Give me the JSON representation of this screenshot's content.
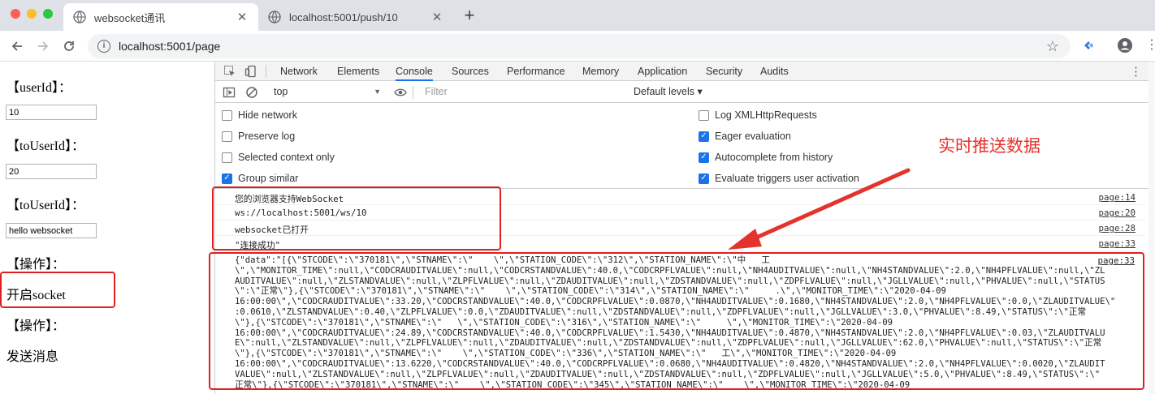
{
  "window": {
    "tabs": [
      {
        "title": "websocket通讯",
        "active": true
      },
      {
        "title": "localhost:5001/push/10",
        "active": false
      }
    ],
    "new_tab_label": "+"
  },
  "toolbar": {
    "url": "localhost:5001/page"
  },
  "page": {
    "userId_label": "【userId】：",
    "userId_value": "10",
    "toUserId_label": "【toUserId】：",
    "toUserId_value": "20",
    "toUserId2_label": "【toUserId】：",
    "message_value": "hello websocket",
    "op1_label": "【操作】：",
    "open_socket": "开启socket",
    "op2_label": "【操作】：",
    "send_message": "发送消息"
  },
  "devtools": {
    "tabs": [
      "Network",
      "Elements",
      "Console",
      "Sources",
      "Performance",
      "Memory",
      "Application",
      "Security",
      "Audits"
    ],
    "active_tab": "Console",
    "context": "top",
    "filter_placeholder": "Filter",
    "levels": "Default levels ▾",
    "settings_left": [
      {
        "label": "Hide network",
        "checked": false
      },
      {
        "label": "Preserve log",
        "checked": false
      },
      {
        "label": "Selected context only",
        "checked": false
      },
      {
        "label": "Group similar",
        "checked": true
      }
    ],
    "settings_right": [
      {
        "label": "Log XMLHttpRequests",
        "checked": false
      },
      {
        "label": "Eager evaluation",
        "checked": true
      },
      {
        "label": "Autocomplete from history",
        "checked": true
      },
      {
        "label": "Evaluate triggers user activation",
        "checked": true
      }
    ],
    "logs": [
      {
        "msg": "您的浏览器支持WebSocket",
        "src": "page:14"
      },
      {
        "msg": "ws://localhost:5001/ws/10",
        "src": "page:20"
      },
      {
        "msg": "websocket已打开",
        "src": "page:28"
      },
      {
        "msg": "\"连接成功\"",
        "src": "page:33"
      }
    ],
    "long_log": {
      "src": "page:33",
      "lines": [
        "{\"data\":\"[{\\\"STCODE\\\":\\\"370181\\\",\\\"STNAME\\\":\\\"    \\\",\\\"STATION_CODE\\\":\\\"312\\\",\\\"STATION_NAME\\\":\\\"中   工",
        "\\\",\\\"MONITOR_TIME\\\":null,\\\"CODCRAUDITVALUE\\\":null,\\\"CODCRSTANDVALUE\\\":40.0,\\\"CODCRPFLVALUE\\\":null,\\\"NH4AUDITVALUE\\\":null,\\\"NH4STANDVALUE\\\":2.0,\\\"NH4PFLVALUE\\\":null,\\\"ZL",
        "AUDITVALUE\\\":null,\\\"ZLSTANDVALUE\\\":null,\\\"ZLPFLVALUE\\\":null,\\\"ZDAUDITVALUE\\\":null,\\\"ZDSTANDVALUE\\\":null,\\\"ZDPFLVALUE\\\":null,\\\"JGLLVALUE\\\":null,\\\"PHVALUE\\\":null,\\\"STATUS",
        "\\\":\\\"正常\\\"},{\\\"STCODE\\\":\\\"370181\\\",\\\"STNAME\\\":\\\"    \\\",\\\"STATION_CODE\\\":\\\"314\\\",\\\"STATION_NAME\\\":\\\"     .\\\",\\\"MONITOR_TIME\\\":\\\"2020-04-09",
        "16:00:00\\\",\\\"CODCRAUDITVALUE\\\":33.20,\\\"CODCRSTANDVALUE\\\":40.0,\\\"CODCRPFLVALUE\\\":0.0870,\\\"NH4AUDITVALUE\\\":0.1680,\\\"NH4STANDVALUE\\\":2.0,\\\"NH4PFLVALUE\\\":0.0,\\\"ZLAUDITVALUE\\\"",
        ":0.0610,\\\"ZLSTANDVALUE\\\":0.40,\\\"ZLPFLVALUE\\\":0.0,\\\"ZDAUDITVALUE\\\":null,\\\"ZDSTANDVALUE\\\":null,\\\"ZDPFLVALUE\\\":null,\\\"JGLLVALUE\\\":3.0,\\\"PHVALUE\\\":8.49,\\\"STATUS\\\":\\\"正常",
        "\\\"},{\\\"STCODE\\\":\\\"370181\\\",\\\"STNAME\\\":\\\"   \\\",\\\"STATION_CODE\\\":\\\"316\\\",\\\"STATION_NAME\\\":\\\"     \\\",\\\"MONITOR_TIME\\\":\\\"2020-04-09",
        "16:00:00\\\",\\\"CODCRAUDITVALUE\\\":24.89,\\\"CODCRSTANDVALUE\\\":40.0,\\\"CODCRPFLVALUE\\\":1.5430,\\\"NH4AUDITVALUE\\\":0.4870,\\\"NH4STANDVALUE\\\":2.0,\\\"NH4PFLVALUE\\\":0.03,\\\"ZLAUDITVALU",
        "E\\\":null,\\\"ZLSTANDVALUE\\\":null,\\\"ZLPFLVALUE\\\":null,\\\"ZDAUDITVALUE\\\":null,\\\"ZDSTANDVALUE\\\":null,\\\"ZDPFLVALUE\\\":null,\\\"JGLLVALUE\\\":62.0,\\\"PHVALUE\\\":null,\\\"STATUS\\\":\\\"正常",
        "\\\"},{\\\"STCODE\\\":\\\"370181\\\",\\\"STNAME\\\":\\\"    \\\",\\\"STATION_CODE\\\":\\\"336\\\",\\\"STATION_NAME\\\":\\\"   工\\\",\\\"MONITOR_TIME\\\":\\\"2020-04-09",
        "16:00:00\\\",\\\"CODCRAUDITVALUE\\\":13.6220,\\\"CODCRSTANDVALUE\\\":40.0,\\\"CODCRPFLVALUE\\\":0.0680,\\\"NH4AUDITVALUE\\\":0.4820,\\\"NH4STANDVALUE\\\":2.0,\\\"NH4PFLVALUE\\\":0.0020,\\\"ZLAUDIT",
        "VALUE\\\":null,\\\"ZLSTANDVALUE\\\":null,\\\"ZLPFLVALUE\\\":null,\\\"ZDAUDITVALUE\\\":null,\\\"ZDSTANDVALUE\\\":null,\\\"ZDPFLVALUE\\\":null,\\\"JGLLVALUE\\\":5.0,\\\"PHVALUE\\\":8.49,\\\"STATUS\\\":\\\"",
        "正常\\\"},{\\\"STCODE\\\":\\\"370181\\\",\\\"STNAME\\\":\\\"    \\\",\\\"STATION_CODE\\\":\\\"345\\\",\\\"STATION_NAME\\\":\\\"    \\\",\\\"MONITOR_TIME\\\":\\\"2020-04-09"
      ]
    },
    "annotation": "实时推送数据"
  },
  "colors": {
    "accent": "#1a73e8",
    "annotation_red": "#e4332d",
    "highlight_box": "#e02020"
  }
}
